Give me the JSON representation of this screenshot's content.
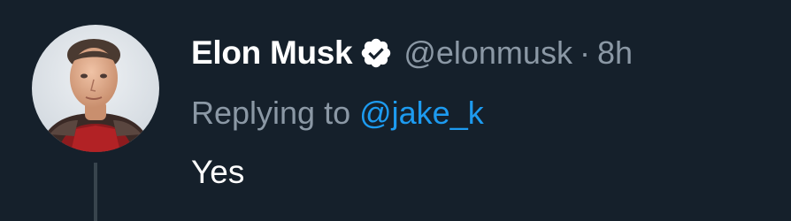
{
  "tweet": {
    "author": {
      "display_name": "Elon Musk",
      "handle": "@elonmusk",
      "verified_icon": "verified-badge-icon",
      "avatar_icon": "profile-photo"
    },
    "separator": "·",
    "timestamp": "8h",
    "reply": {
      "prefix": "Replying to",
      "mention": "@jake_k"
    },
    "text": "Yes"
  },
  "colors": {
    "background": "#15202b",
    "primary_text": "#ffffff",
    "secondary_text": "#8b98a5",
    "link": "#1d9bf0",
    "thread_line": "#38444d"
  }
}
